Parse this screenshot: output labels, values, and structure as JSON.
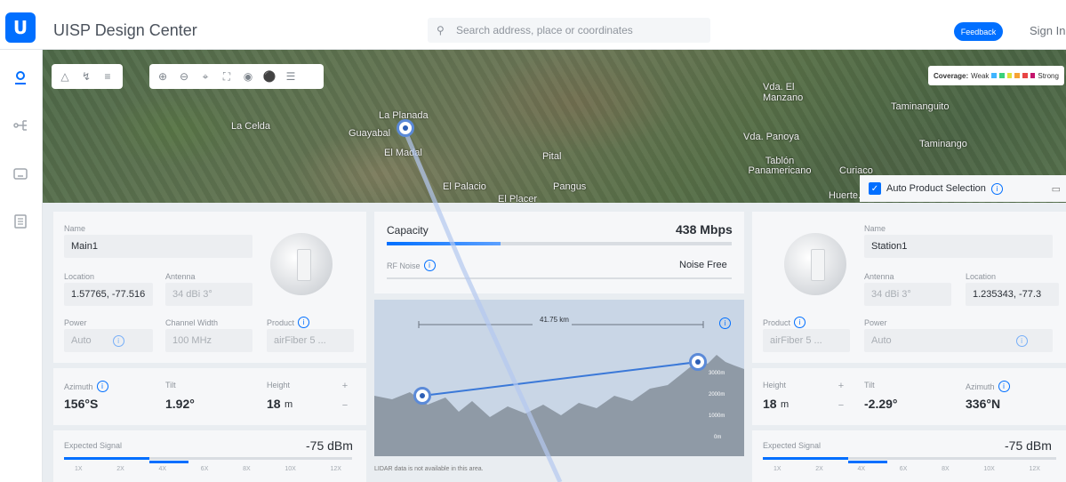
{
  "header": {
    "logo_text": "U",
    "title": "UISP Design Center",
    "search_placeholder": "Search address, place or coordinates",
    "feedback_label": "Feedback",
    "signin_label": "Sign In"
  },
  "map": {
    "labels": {
      "la_celda": "La Celda",
      "la_planada": "La Planada",
      "guayabal": "Guayabal",
      "el_madal": "El Madal",
      "pital": "Pital",
      "el_palacio": "El Palacio",
      "pangus": "Pangus",
      "el_placer": "El Placer",
      "vda_el_manzano": "Vda. El Manzano",
      "taminanguito": "Taminanguito",
      "taminango": "Taminango",
      "vda_panoya": "Vda. Panoya",
      "tablon": "Tablón Panamericano",
      "curiaco": "Curiaco",
      "huertecillas": "Huerte..."
    },
    "coverage": {
      "label": "Coverage:",
      "weak": "Weak",
      "strong": "Strong",
      "colors": [
        "#3fb4ff",
        "#39d17a",
        "#e0e03a",
        "#f7a233",
        "#e84545",
        "#c4146c"
      ]
    }
  },
  "auto_product": {
    "label": "Auto Product Selection",
    "checked": true
  },
  "left_device": {
    "name_label": "Name",
    "name": "Main1",
    "location_label": "Location",
    "location": "1.57765, -77.516",
    "antenna_label": "Antenna",
    "antenna": "34 dBi 3°",
    "power_label": "Power",
    "power": "Auto",
    "channel_width_label": "Channel Width",
    "channel_width": "100 MHz",
    "product_label": "Product",
    "product": "airFiber 5 ...",
    "azimuth_label": "Azimuth",
    "azimuth": "156°S",
    "tilt_label": "Tilt",
    "tilt": "1.92°",
    "height_label": "Height",
    "height": "18",
    "height_unit": "m",
    "signal_label": "Expected Signal",
    "signal": "-75 dBm",
    "ticks": [
      "1X",
      "2X",
      "4X",
      "6X",
      "8X",
      "10X",
      "12X"
    ]
  },
  "right_device": {
    "name_label": "Name",
    "name": "Station1",
    "antenna_label": "Antenna",
    "antenna": "34 dBi 3°",
    "location_label": "Location",
    "location": "1.235343, -77.3",
    "product_label": "Product",
    "product": "airFiber 5 ...",
    "power_label": "Power",
    "power": "Auto",
    "height_label": "Height",
    "height": "18",
    "height_unit": "m",
    "tilt_label": "Tilt",
    "tilt": "-2.29°",
    "azimuth_label": "Azimuth",
    "azimuth": "336°N",
    "signal_label": "Expected Signal",
    "signal": "-75 dBm",
    "ticks": [
      "1X",
      "2X",
      "4X",
      "6X",
      "8X",
      "10X",
      "12X"
    ]
  },
  "link": {
    "capacity_label": "Capacity",
    "capacity": "438 Mbps",
    "capacity_fraction": 0.33,
    "rf_noise_label": "RF Noise",
    "rf_noise": "Noise Free",
    "distance": "41.75 km",
    "elevations": [
      "3000m",
      "2000m",
      "1000m",
      "0m"
    ],
    "lidar_note": "LIDAR data is not available in this area."
  }
}
